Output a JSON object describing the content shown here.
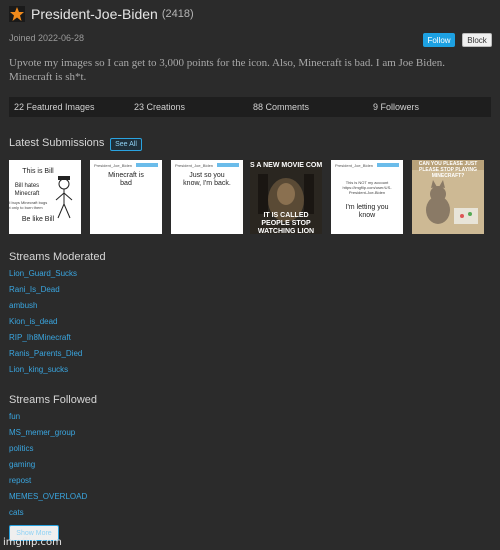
{
  "profile": {
    "username": "President-Joe-Biden",
    "points": "(2418)",
    "joined": "Joined 2022-06-28",
    "follow_label": "Follow",
    "block_label": "Block",
    "bio": "Upvote my images so I can get to 3,000 points for the icon. Also, Minecraft is bad. I am Joe Biden. Minecraft is sh*t."
  },
  "stats": {
    "featured": "22 Featured Images",
    "creations": "23 Creations",
    "comments": "88 Comments",
    "followers": "9 Followers"
  },
  "submissions": {
    "title": "Latest Submissions",
    "see_all_label": "See All",
    "items": [
      {
        "icon": "bill-meme-thumbnail",
        "lines": [
          "This is Bill",
          "Bill hates Minecraft",
          "Bill buys Minecraft bugs but only to burn them",
          "Be like Bill"
        ]
      },
      {
        "icon": "announcement-template-thumbnail",
        "header": "President_Joe_Biden",
        "text": "Minecraft is bad"
      },
      {
        "icon": "announcement-template-thumbnail",
        "header": "President_Joe_Biden",
        "text": "Just so you know, I'm back."
      },
      {
        "icon": "movie-meme-thumbnail",
        "top": "S A NEW MOVIE COMI",
        "bottom": "IT IS CALLED PEOPLE STOP WATCHING LION"
      },
      {
        "icon": "announcement-template-thumbnail",
        "header": "President_Joe_Biden",
        "small": "This is NOT my account https://imgflip.com/user/US-President-Joe-Biden",
        "text": "I'm letting you know"
      },
      {
        "icon": "cat-meme-thumbnail",
        "top": "CAN YOU PLEASE JUST PLEASE STOP PLAYING MINECRAFT?"
      }
    ]
  },
  "moderated": {
    "title": "Streams Moderated",
    "items": [
      "Lion_Guard_Sucks",
      "Rani_Is_Dead",
      "ambush",
      "Kion_is_dead",
      "RIP_Ih8Minecraft",
      "Ranis_Parents_Died",
      "Lion_king_sucks"
    ]
  },
  "followed": {
    "title": "Streams Followed",
    "items": [
      "fun",
      "MS_memer_group",
      "politics",
      "gaming",
      "repost",
      "MEMES_OVERLOAD",
      "cats"
    ],
    "show_more_label": "Show More"
  },
  "watermark": "imgflip.com",
  "colors": {
    "background": "#2b2b2b",
    "link": "#3aa6e0",
    "accent": "#1da1e2",
    "star": "#f08a1c"
  }
}
